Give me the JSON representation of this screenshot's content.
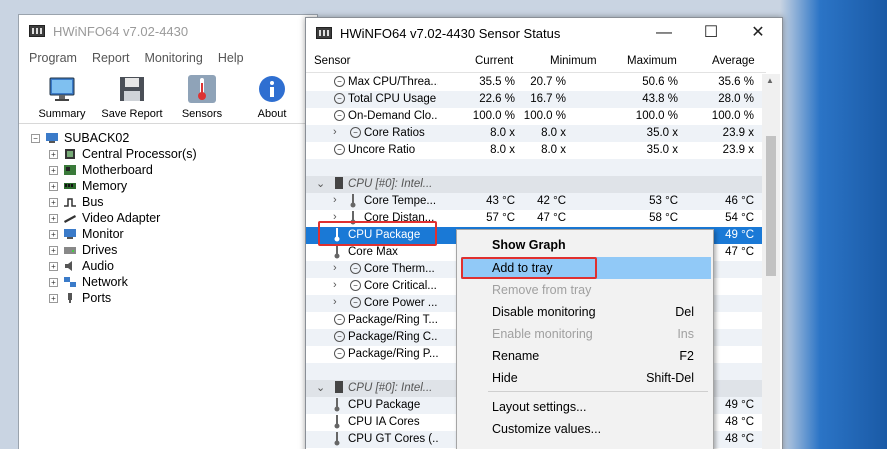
{
  "main_window": {
    "title": "HWiNFO64 v7.02-4430",
    "menu": [
      "Program",
      "Report",
      "Monitoring",
      "Help"
    ],
    "toolbar": [
      {
        "label": "Summary",
        "icon": "monitor-icon"
      },
      {
        "label": "Save Report",
        "icon": "floppy-icon"
      },
      {
        "label": "Sensors",
        "icon": "thermometer-icon"
      },
      {
        "label": "About",
        "icon": "info-icon"
      }
    ],
    "tree_root": "SUBACK02",
    "tree_items": [
      "Central Processor(s)",
      "Motherboard",
      "Memory",
      "Bus",
      "Video Adapter",
      "Monitor",
      "Drives",
      "Audio",
      "Network",
      "Ports"
    ]
  },
  "sensor_window": {
    "title": "HWiNFO64 v7.02-4430 Sensor Status",
    "controls": {
      "minimize": "—",
      "maximize": "☐",
      "close": "✕"
    },
    "columns": {
      "sensor": "Sensor",
      "current": "Current",
      "minimum": "Minimum",
      "maximum": "Maximum",
      "average": "Average"
    },
    "rows": [
      {
        "name": "Max CPU/Threa...",
        "icon": "clock",
        "cur": "35.5 %",
        "min": "20.7 %",
        "max": "50.6 %",
        "avg": "35.6 %"
      },
      {
        "name": "Total CPU Usage",
        "icon": "clock",
        "cur": "22.6 %",
        "min": "16.7 %",
        "max": "43.8 %",
        "avg": "28.0 %"
      },
      {
        "name": "On-Demand Clo...",
        "icon": "clock",
        "cur": "100.0 %",
        "min": "100.0 %",
        "max": "100.0 %",
        "avg": "100.0 %"
      },
      {
        "name": "Core Ratios",
        "icon": "clock-chev",
        "cur": "8.0 x",
        "min": "8.0 x",
        "max": "35.0 x",
        "avg": "23.9 x"
      },
      {
        "name": "Uncore Ratio",
        "icon": "clock",
        "cur": "8.0 x",
        "min": "8.0 x",
        "max": "35.0 x",
        "avg": "23.9 x"
      },
      {
        "name": "",
        "icon": "blank",
        "cur": "",
        "min": "",
        "max": "",
        "avg": ""
      },
      {
        "name": "CPU [#0]: Intel...",
        "icon": "group",
        "cur": "",
        "min": "",
        "max": "",
        "avg": ""
      },
      {
        "name": "Core Tempe...",
        "icon": "therm-chev",
        "cur": "43 °C",
        "min": "42 °C",
        "max": "53 °C",
        "avg": "46 °C"
      },
      {
        "name": "Core Distan...",
        "icon": "therm-chev",
        "cur": "57 °C",
        "min": "47 °C",
        "max": "58 °C",
        "avg": "54 °C"
      },
      {
        "name": "CPU Package",
        "icon": "therm",
        "cur": "",
        "min": "",
        "max": "",
        "avg": "49 °C"
      },
      {
        "name": "Core Max",
        "icon": "therm",
        "cur": "",
        "min": "",
        "max": "",
        "avg": "47 °C"
      },
      {
        "name": "Core Therm...",
        "icon": "clock-chev",
        "cur": "",
        "min": "",
        "max": "",
        "avg": ""
      },
      {
        "name": "Core Critical...",
        "icon": "clock-chev",
        "cur": "",
        "min": "",
        "max": "",
        "avg": ""
      },
      {
        "name": "Core Power ...",
        "icon": "clock-chev",
        "cur": "",
        "min": "",
        "max": "",
        "avg": ""
      },
      {
        "name": "Package/Ring T...",
        "icon": "clock",
        "cur": "",
        "min": "",
        "max": "",
        "avg": ""
      },
      {
        "name": "Package/Ring C...",
        "icon": "clock",
        "cur": "",
        "min": "",
        "max": "",
        "avg": ""
      },
      {
        "name": "Package/Ring P...",
        "icon": "clock",
        "cur": "",
        "min": "",
        "max": "",
        "avg": ""
      },
      {
        "name": "",
        "icon": "blank",
        "cur": "",
        "min": "",
        "max": "",
        "avg": ""
      },
      {
        "name": "CPU [#0]: Intel...",
        "icon": "group",
        "cur": "",
        "min": "",
        "max": "",
        "avg": ""
      },
      {
        "name": "CPU Package",
        "icon": "therm",
        "cur": "",
        "min": "",
        "max": "",
        "avg": "49 °C"
      },
      {
        "name": "CPU IA Cores",
        "icon": "therm",
        "cur": "",
        "min": "",
        "max": "",
        "avg": "48 °C"
      },
      {
        "name": "CPU GT Cores (...",
        "icon": "therm",
        "cur": "",
        "min": "",
        "max": "",
        "avg": "48 °C"
      }
    ]
  },
  "context_menu": {
    "items": [
      {
        "label": "Show Graph",
        "key": "",
        "state": "bold"
      },
      {
        "label": "Add to tray",
        "key": "",
        "state": "highlight"
      },
      {
        "label": "Remove from tray",
        "key": "",
        "state": "disabled"
      },
      {
        "label": "Disable monitoring",
        "key": "Del",
        "state": "normal"
      },
      {
        "label": "Enable monitoring",
        "key": "Ins",
        "state": "disabled"
      },
      {
        "label": "Rename",
        "key": "F2",
        "state": "normal"
      },
      {
        "label": "Hide",
        "key": "Shift-Del",
        "state": "normal"
      },
      {
        "label": "Layout settings...",
        "key": "",
        "state": "normal"
      },
      {
        "label": "Customize values...",
        "key": "",
        "state": "normal"
      },
      {
        "label": "",
        "key": "",
        "state": "normal"
      }
    ]
  },
  "colors": {
    "selection": "#1a79d6",
    "menu_highlight": "#91c9f7",
    "annotation_red": "#e0302f"
  }
}
